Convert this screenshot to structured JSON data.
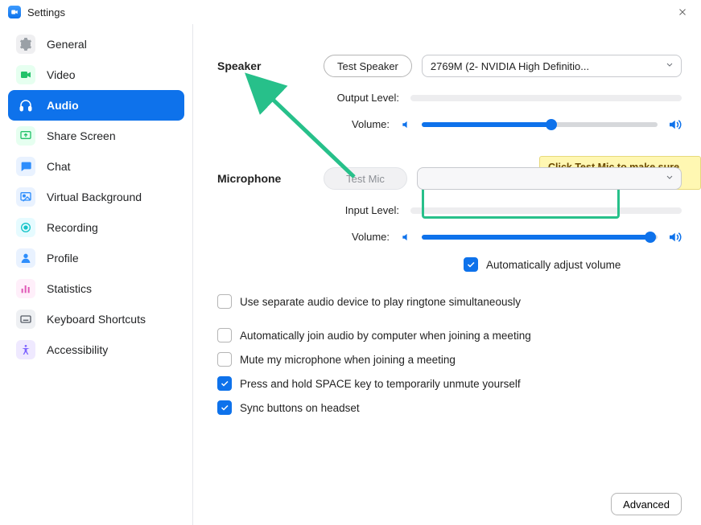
{
  "window": {
    "title": "Settings"
  },
  "sidebar": {
    "items": [
      {
        "label": "General"
      },
      {
        "label": "Video"
      },
      {
        "label": "Audio"
      },
      {
        "label": "Share Screen"
      },
      {
        "label": "Chat"
      },
      {
        "label": "Virtual Background"
      },
      {
        "label": "Recording"
      },
      {
        "label": "Profile"
      },
      {
        "label": "Statistics"
      },
      {
        "label": "Keyboard Shortcuts"
      },
      {
        "label": "Accessibility"
      }
    ],
    "active_index": 2
  },
  "audio": {
    "speaker": {
      "section_label": "Speaker",
      "test_button": "Test Speaker",
      "device_selected": "2769M (2- NVIDIA High Definitio...",
      "output_level_label": "Output Level:",
      "volume_label": "Volume:",
      "volume_percent": 55
    },
    "microphone": {
      "section_label": "Microphone",
      "test_button": "Test Mic",
      "device_selected": "",
      "input_level_label": "Input Level:",
      "volume_label": "Volume:",
      "volume_percent": 97,
      "auto_adjust_label": "Automatically adjust volume",
      "auto_adjust_checked": true
    },
    "tooltip_text": "Click Test Mic to make sure others can hear you",
    "options": {
      "separate_device": {
        "label": "Use separate audio device to play ringtone simultaneously",
        "checked": false
      },
      "auto_join_audio": {
        "label": "Automatically join audio by computer when joining a meeting",
        "checked": false
      },
      "mute_on_join": {
        "label": "Mute my microphone when joining a meeting",
        "checked": false
      },
      "space_unmute": {
        "label": "Press and hold SPACE key to temporarily unmute yourself",
        "checked": true
      },
      "sync_headset": {
        "label": "Sync buttons on headset",
        "checked": true
      }
    },
    "advanced_button": "Advanced"
  },
  "colors": {
    "accent": "#0E72EB",
    "highlight": "#27c08a",
    "tooltip_bg": "#fff7b2"
  }
}
